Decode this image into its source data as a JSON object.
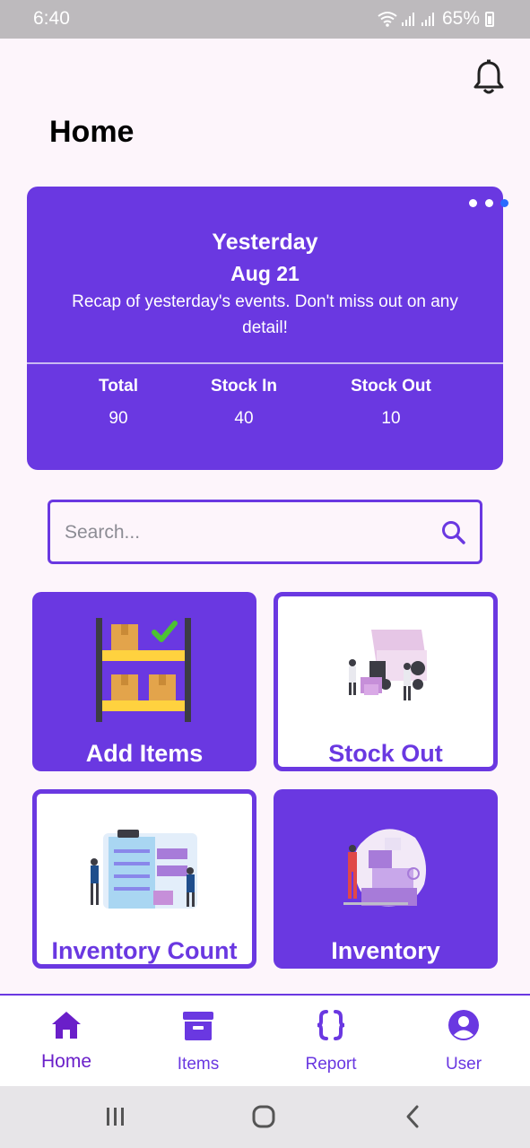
{
  "status_bar": {
    "time": "6:40",
    "battery": "65%",
    "icons": [
      "wifi-icon",
      "signal-icon",
      "signal-icon",
      "battery-icon"
    ]
  },
  "header": {
    "title": "Home",
    "notification_icon": "bell-icon"
  },
  "recap": {
    "title": "Yesterday",
    "date": "Aug 21",
    "description": "Recap of yesterday's events. Don't miss out on any detail!",
    "carousel_pages": 3,
    "carousel_active": 3,
    "stats": [
      {
        "label": "Total",
        "value": "90"
      },
      {
        "label": "Stock In",
        "value": "40"
      },
      {
        "label": "Stock Out",
        "value": "10"
      }
    ]
  },
  "search": {
    "placeholder": "Search...",
    "value": ""
  },
  "tiles": [
    {
      "label": "Add Items",
      "style": "filled",
      "icon": "shelf-boxes-icon"
    },
    {
      "label": "Stock Out",
      "style": "outlined",
      "icon": "delivery-truck-illustration"
    },
    {
      "label": "Inventory Count",
      "style": "outlined",
      "icon": "clipboard-checklist-illustration"
    },
    {
      "label": "Inventory",
      "style": "filled",
      "icon": "inventory-boxes-illustration"
    }
  ],
  "bottom_nav": {
    "items": [
      {
        "label": "Home",
        "icon": "home-icon",
        "active": true
      },
      {
        "label": "Items",
        "icon": "archive-box-icon",
        "active": false
      },
      {
        "label": "Report",
        "icon": "braces-icon",
        "active": false
      },
      {
        "label": "User",
        "icon": "user-circle-icon",
        "active": false
      }
    ]
  },
  "system_nav": [
    "recent-apps-icon",
    "home-circle-icon",
    "back-icon"
  ],
  "colors": {
    "accent": "#6A38E1",
    "background": "#FDF5FB",
    "active_dot": "#2A6BFF",
    "status_bar": "#BDBABD"
  }
}
